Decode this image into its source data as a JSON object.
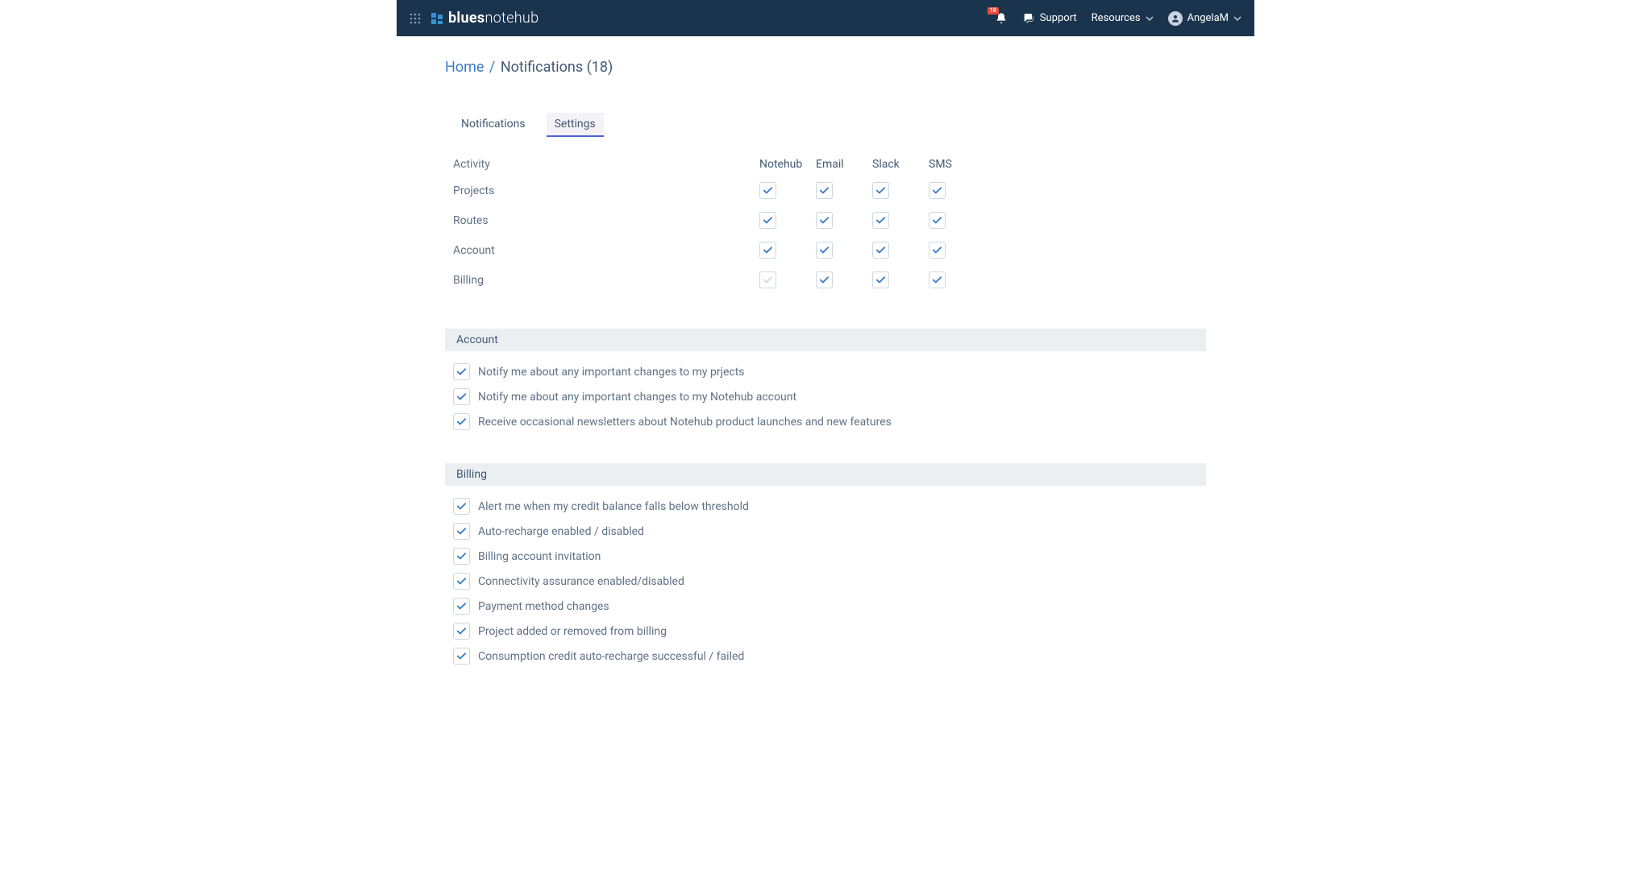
{
  "header": {
    "logo_bold": "blues",
    "logo_light": "notehub",
    "notification_badge": "18",
    "support": "Support",
    "resources": "Resources",
    "username": "AngelaM"
  },
  "breadcrumb": {
    "home": "Home",
    "sep": "/",
    "current": "Notifications (18)"
  },
  "tabs": {
    "notifications": "Notifications",
    "settings": "Settings"
  },
  "table": {
    "col_activity": "Activity",
    "col_notehub": "Notehub",
    "col_email": "Email",
    "col_slack": "Slack",
    "col_sms": "SMS",
    "rows": [
      {
        "label": "Projects",
        "checks": [
          "on",
          "on",
          "on",
          "on"
        ]
      },
      {
        "label": "Routes",
        "checks": [
          "on",
          "on",
          "on",
          "on"
        ]
      },
      {
        "label": "Account",
        "checks": [
          "on",
          "on",
          "on",
          "on"
        ]
      },
      {
        "label": "Billing",
        "checks": [
          "off",
          "on",
          "on",
          "on"
        ]
      }
    ]
  },
  "sections": {
    "account": {
      "title": "Account",
      "options": [
        "Notify me about any important changes to my prjects",
        "Notify me about any important changes to my Notehub account",
        "Receive occasional newsletters about Notehub product launches and new features"
      ]
    },
    "billing": {
      "title": "Billing",
      "options": [
        "Alert me when my credit balance falls below threshold",
        "Auto-recharge enabled / disabled",
        "Billing account invitation",
        "Connectivity assurance enabled/disabled",
        "Payment method changes",
        "Project added or removed from billing",
        "Consumption credit auto-recharge successful / failed"
      ]
    }
  }
}
